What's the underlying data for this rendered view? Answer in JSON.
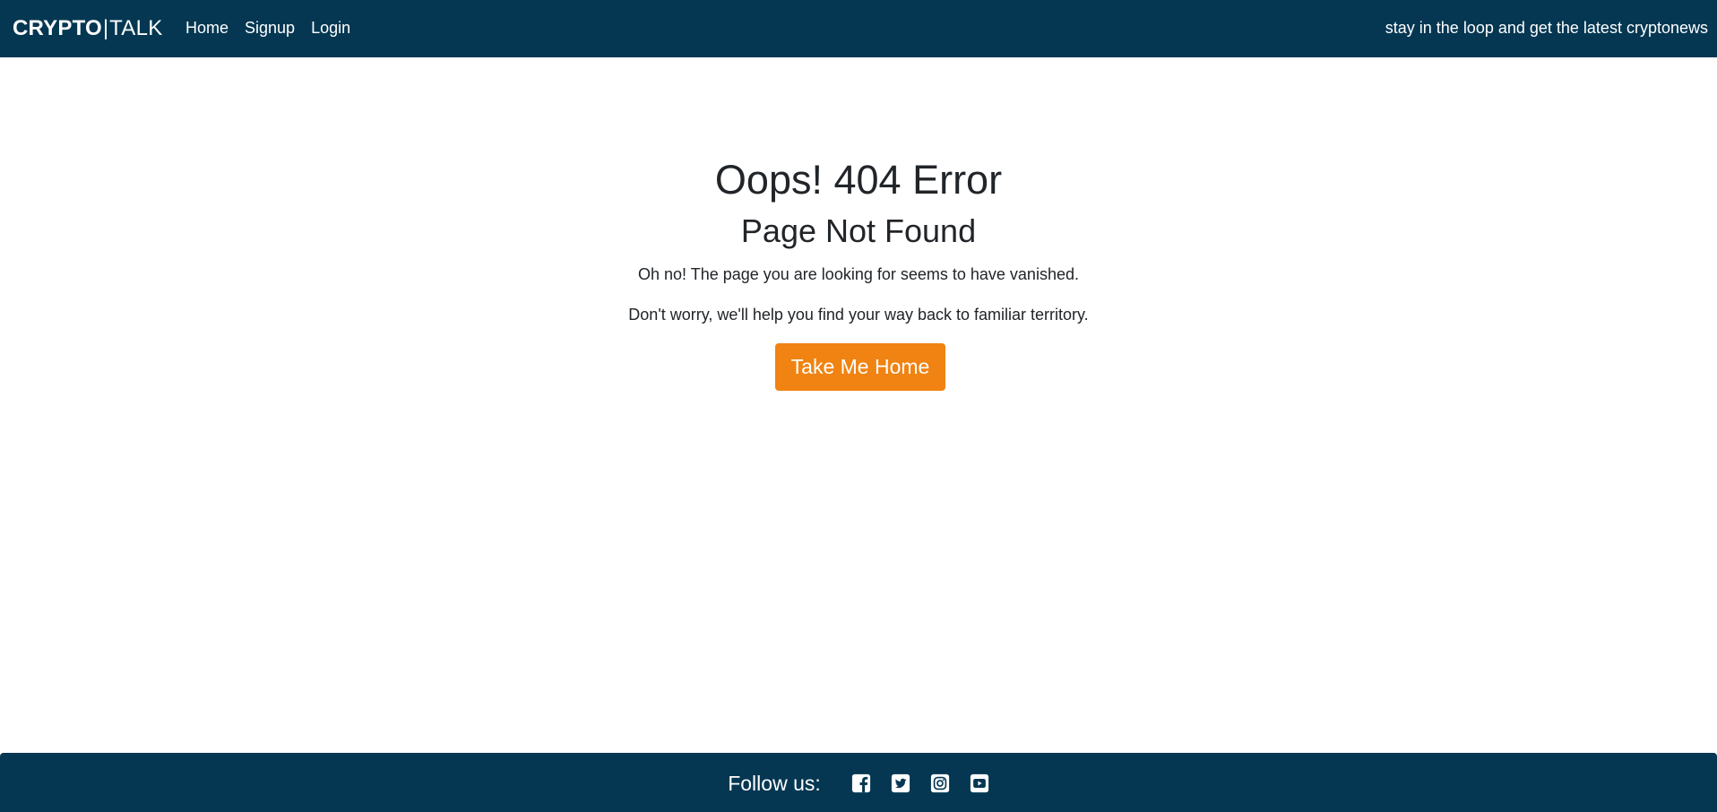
{
  "navbar": {
    "brand_bold": "CRYPTO",
    "brand_separator": "|",
    "brand_light": "TALK",
    "links": [
      "Home",
      "Signup",
      "Login"
    ],
    "tagline": "stay in the loop and get the latest cryptonews"
  },
  "main": {
    "title": "Oops! 404 Error",
    "subtitle": "Page Not Found",
    "text_1": "Oh no! The page you are looking for seems to have vanished.",
    "text_2": "Don't worry, we'll help you find your way back to familiar territory.",
    "button_label": "Take Me Home"
  },
  "footer": {
    "follow_label": "Follow us:",
    "social_icons": [
      "facebook-icon",
      "twitter-icon",
      "instagram-icon",
      "youtube-icon"
    ]
  },
  "colors": {
    "navbar_bg": "#053752",
    "accent_button": "#f08311",
    "text": "#212529",
    "background": "#ffffff"
  }
}
